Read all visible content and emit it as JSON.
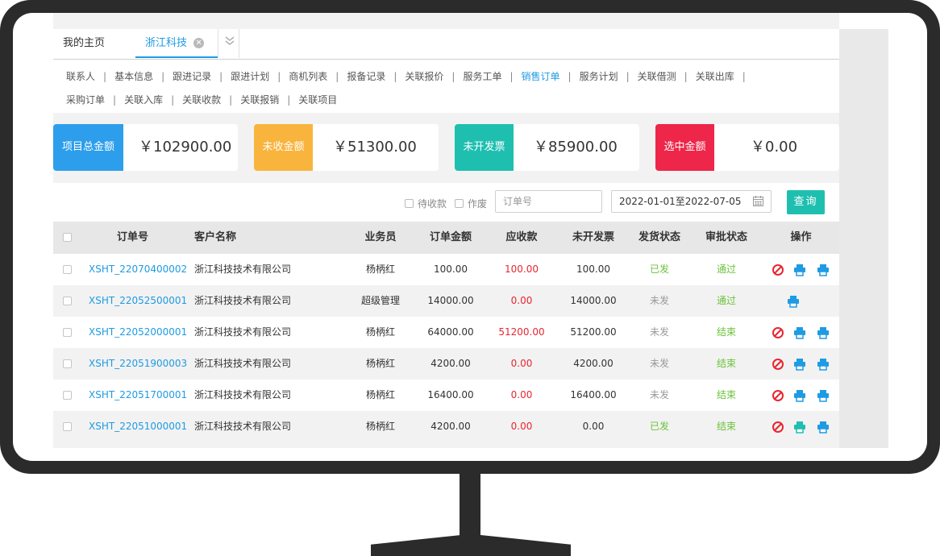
{
  "tabs": [
    {
      "label": "我的主页"
    },
    {
      "label": "浙江科技"
    }
  ],
  "subnav": {
    "row1": [
      "联系人",
      "基本信息",
      "跟进记录",
      "跟进计划",
      "商机列表",
      "报备记录",
      "关联报价",
      "服务工单",
      "销售订单",
      "服务计划",
      "关联借测",
      "关联出库"
    ],
    "row2": [
      "采购订单",
      "关联入库",
      "关联收款",
      "关联报销",
      "关联项目"
    ],
    "active": "销售订单"
  },
  "stats": [
    {
      "label": "项目总金额",
      "value": "￥102900.00",
      "color": "#2d9eec"
    },
    {
      "label": "未收金额",
      "value": "￥51300.00",
      "color": "#f9b43d"
    },
    {
      "label": "未开发票",
      "value": "￥85900.00",
      "color": "#1fbfb0"
    },
    {
      "label": "选中金额",
      "value": "￥0.00",
      "color": "#ee2649"
    }
  ],
  "filters": {
    "pending_label": "待收款",
    "void_label": "作废",
    "order_placeholder": "订单号",
    "date_range": "2022-01-01至2022-07-05",
    "query_label": "查询"
  },
  "table": {
    "headers": [
      "订单号",
      "客户名称",
      "业务员",
      "订单金额",
      "应收款",
      "未开发票",
      "发货状态",
      "审批状态",
      "操作"
    ],
    "rows": [
      {
        "order": "XSHT_22070400002",
        "customer": "浙江科技技术有限公司",
        "sales": "杨柄红",
        "amount": "100.00",
        "receivable": "100.00",
        "uninvoiced": "100.00",
        "ship": "已发",
        "approval": "通过",
        "ops": [
          "ban",
          "print",
          "print"
        ]
      },
      {
        "order": "XSHT_22052500001",
        "customer": "浙江科技技术有限公司",
        "sales": "超级管理",
        "amount": "14000.00",
        "receivable": "0.00",
        "uninvoiced": "14000.00",
        "ship": "未发",
        "approval": "通过",
        "ops": [
          "print"
        ]
      },
      {
        "order": "XSHT_22052000001",
        "customer": "浙江科技技术有限公司",
        "sales": "杨柄红",
        "amount": "64000.00",
        "receivable": "51200.00",
        "uninvoiced": "51200.00",
        "ship": "未发",
        "approval": "结束",
        "ops": [
          "ban",
          "print",
          "print"
        ]
      },
      {
        "order": "XSHT_22051900003",
        "customer": "浙江科技技术有限公司",
        "sales": "杨柄红",
        "amount": "4200.00",
        "receivable": "0.00",
        "uninvoiced": "4200.00",
        "ship": "未发",
        "approval": "结束",
        "ops": [
          "ban",
          "print",
          "print"
        ]
      },
      {
        "order": "XSHT_22051700001",
        "customer": "浙江科技技术有限公司",
        "sales": "杨柄红",
        "amount": "16400.00",
        "receivable": "0.00",
        "uninvoiced": "16400.00",
        "ship": "未发",
        "approval": "结束",
        "ops": [
          "ban",
          "print",
          "print"
        ]
      },
      {
        "order": "XSHT_22051000001",
        "customer": "浙江科技技术有限公司",
        "sales": "杨柄红",
        "amount": "4200.00",
        "receivable": "0.00",
        "uninvoiced": "0.00",
        "ship": "已发",
        "approval": "结束",
        "ops": [
          "ban",
          "print",
          "print"
        ]
      }
    ]
  },
  "colors": {
    "accent": "#1e9be3",
    "danger": "#e8262f",
    "success": "#6bc33b",
    "teal": "#1fbfb0"
  }
}
